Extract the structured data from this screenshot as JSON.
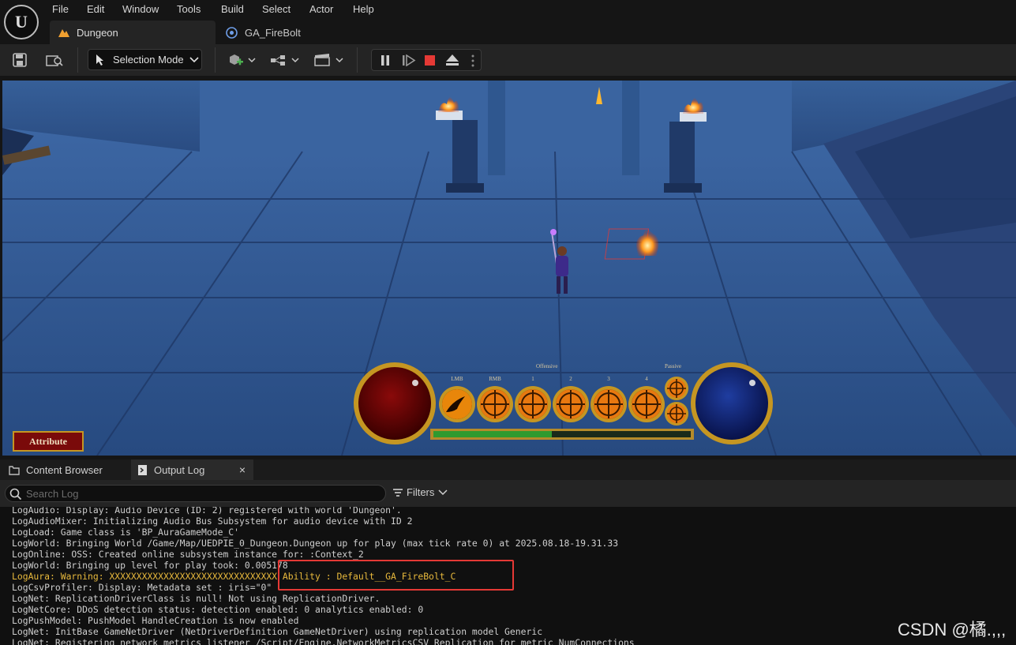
{
  "menu": {
    "items": [
      "File",
      "Edit",
      "Window",
      "Tools",
      "Build",
      "Select",
      "Actor",
      "Help"
    ],
    "logo": "U"
  },
  "tabs": [
    {
      "label": "Dungeon",
      "icon": "level-icon"
    },
    {
      "label": "GA_FireBolt",
      "icon": "blueprint-icon"
    }
  ],
  "toolbar": {
    "selection_mode": "Selection Mode"
  },
  "hud": {
    "attribute_button": "Attribute",
    "slot_labels": [
      "LMB",
      "RMB",
      "1",
      "2",
      "3",
      "4"
    ],
    "offensive_label": "Offensive",
    "passive_label": "Passive"
  },
  "panel": {
    "tab_content_browser": "Content Browser",
    "tab_output_log": "Output Log",
    "close_glyph": "×",
    "search_placeholder": "Search Log",
    "filters_label": "Filters"
  },
  "log_lines": [
    {
      "text": "LogAudio: Display: Audio Device (ID: 2) registered with world 'Dungeon'.",
      "warn": false
    },
    {
      "text": "LogAudioMixer: Initializing Audio Bus Subsystem for audio device with ID 2",
      "warn": false
    },
    {
      "text": "LogLoad: Game class is 'BP_AuraGameMode_C'",
      "warn": false
    },
    {
      "text": "LogWorld: Bringing World /Game/Map/UEDPIE_0_Dungeon.Dungeon up for play (max tick rate 0) at 2025.08.18-19.31.33",
      "warn": false
    },
    {
      "text": "LogOnline: OSS: Created online subsystem instance for: :Context_2",
      "warn": false
    },
    {
      "text": "LogWorld: Bringing up level for play took: 0.005178",
      "warn": false
    },
    {
      "text": "LogAura: Warning: XXXXXXXXXXXXXXXXXXXXXXXXXXXXXXX Ability : Default__GA_FireBolt_C",
      "warn": true
    },
    {
      "text": "LogCsvProfiler: Display: Metadata set : iris=\"0\"",
      "warn": false
    },
    {
      "text": "LogNet: ReplicationDriverClass is null! Not using ReplicationDriver.",
      "warn": false
    },
    {
      "text": "LogNetCore: DDoS detection status: detection enabled: 0 analytics enabled: 0",
      "warn": false
    },
    {
      "text": "LogPushModel: PushModel HandleCreation is now enabled",
      "warn": false
    },
    {
      "text": "LogNet: InitBase GameNetDriver (NetDriverDefinition GameNetDriver) using replication model Generic",
      "warn": false
    },
    {
      "text": "LogNet: Registering network metrics listener /Script/Engine.NetworkMetricsCSV_Replication for metric NumConnections",
      "warn": false
    }
  ],
  "watermark": "CSDN @橘.,,,",
  "colors": {
    "warning": "#e8b93c",
    "highlight": "#e53935",
    "play_stop": "#e53935"
  }
}
